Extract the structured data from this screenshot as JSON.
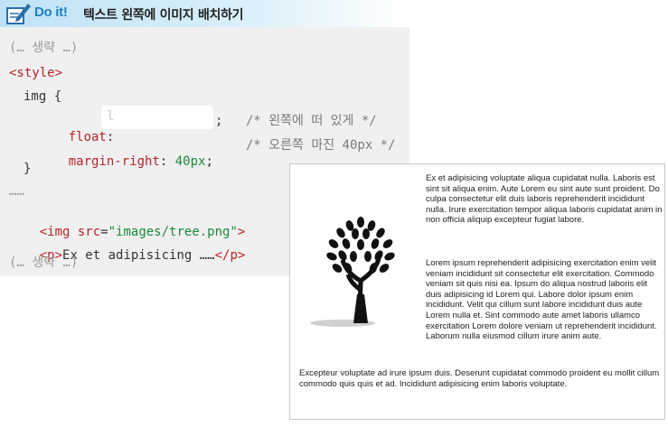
{
  "header": {
    "badge": "Do it!",
    "title": "텍스트 왼쪽에 이미지 배치하기"
  },
  "code": {
    "line1": "(… 생략 …)",
    "line2": "<style>",
    "line3": "img {",
    "float_prop": "float",
    "float_colon": ":",
    "float_input_value": "l",
    "float_semicolon": ";",
    "float_comment": "/* 왼쪽에 떠 있게 */",
    "mr_prop": "margin-right",
    "mr_colon": ":",
    "mr_value": "40px",
    "mr_semicolon": ";",
    "mr_comment": "/* 오른쪽 마진 40px */",
    "line6": "}",
    "line7": "……",
    "img_open": "<img",
    "img_attr": "src",
    "img_eq": "=",
    "img_val": "\"images/tree.png\"",
    "img_close": ">",
    "p_open": "<p>",
    "p_text": "Ex et adipisicing ……",
    "p_close": "</p>",
    "line10": "(… 생략 …)"
  },
  "result": {
    "para1": "Ex et adipisicing voluptate aliqua cupidatat nulla. Laboris est sint sit aliqua enim. Aute Lorem eu sint aute sunt proident. Do culpa consectetur elit duis laboris reprehenderit incididunt nulla. Irure exercitation tempor aliqua laboris cupidatat anim in non officia aliquip excepteur fugiat labore.",
    "para2": "Lorem ipsum reprehenderit adipisicing exercitation enim velit veniam incididunt sit consectetur elit exercitation. Commodo veniam sit quis nisi ea. Ipsum do aliqua nostrud laboris elit duis adipisicing id Lorem qui. Labore dolor ipsum enim incididunt. Velit qui cillum sunt labore incididunt duis aute Lorem nulla et. Sint commodo aute amet laboris ullamco exercitation Lorem dolore veniam ut reprehenderit incididunt. Laborum nulla eiusmod cillum irure anim aute.",
    "para3": "Excepteur voluptate ad irure ipsum duis. Deserunt cupidatat commodo proident eu mollit cillum commodo quis quis et ad. Incididunt adipisicing enim laboris voluptate."
  },
  "colors": {
    "tag": "#b4262a",
    "value": "#1b8a3c",
    "badge": "#1e7fc2",
    "code_bg": "#f0f0f0"
  },
  "icons": [
    "pencil-note-icon",
    "tree-image"
  ]
}
